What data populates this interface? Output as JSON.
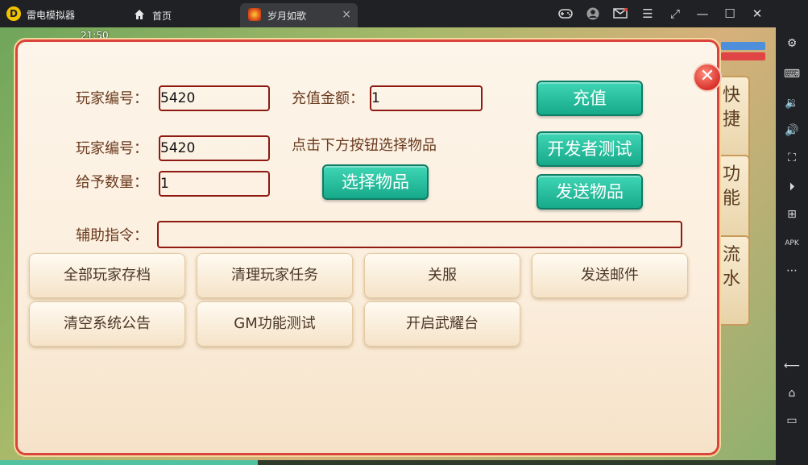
{
  "window": {
    "app_name": "雷电模拟器",
    "logo_letter": "D",
    "tabs": [
      {
        "label": "首页",
        "icon": "home-icon"
      },
      {
        "label": "岁月如歌",
        "icon": "game-icon",
        "close": "×"
      }
    ],
    "controls": [
      "gamepad-icon",
      "user-icon",
      "mail-icon",
      "menu-icon",
      "expand-icon",
      "minimize-icon",
      "maximize-icon",
      "close-icon"
    ]
  },
  "game_hud": {
    "time": "21:50",
    "side_tabs": [
      "快捷",
      "功能",
      "流水"
    ]
  },
  "dialog": {
    "row1": {
      "label": "玩家编号：",
      "value": "5420",
      "label2": "充值金额：",
      "value2": "1",
      "button": "充值"
    },
    "row2": {
      "label": "玩家编号：",
      "value": "5420",
      "hint": "点击下方按钮选择物品",
      "button": "开发者测试"
    },
    "row3": {
      "label": "给予数量：",
      "value": "1",
      "select_button": "选择物品",
      "send_button": "发送物品"
    },
    "row4": {
      "label": "辅助指令：",
      "value": ""
    },
    "actions": [
      "全部玩家存档",
      "清理玩家任务",
      "关服",
      "发送邮件",
      "清空系统公告",
      "GM功能测试",
      "开启武耀台"
    ]
  },
  "colors": {
    "accent_green": "#17a98a",
    "field_border": "#8e1a12",
    "panel_border": "#d9443b"
  }
}
